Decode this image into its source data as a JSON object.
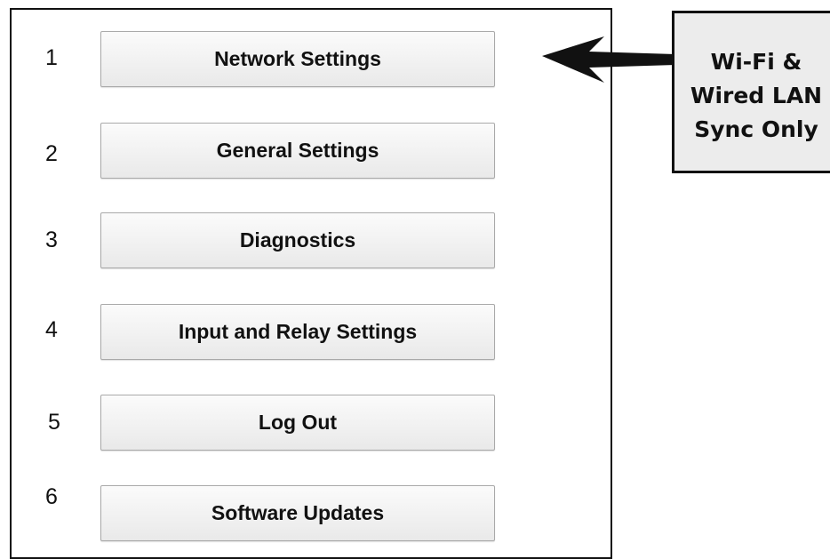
{
  "menu": {
    "items": [
      {
        "number": "1",
        "label": "Network Settings"
      },
      {
        "number": "2",
        "label": "General Settings"
      },
      {
        "number": "3",
        "label": "Diagnostics"
      },
      {
        "number": "4",
        "label": "Input and Relay Settings"
      },
      {
        "number": "5",
        "label": "Log Out"
      },
      {
        "number": "6",
        "label": "Software Updates"
      }
    ]
  },
  "callout": {
    "lines": [
      "Wi-Fi &",
      "Wired LAN",
      "Sync Only"
    ]
  },
  "icons": {
    "arrow": "arrow-left-icon"
  },
  "colors": {
    "button_top": "#fbfbfb",
    "button_bottom": "#e9e9e9",
    "callout_background": "#ececec",
    "border": "#111111"
  }
}
